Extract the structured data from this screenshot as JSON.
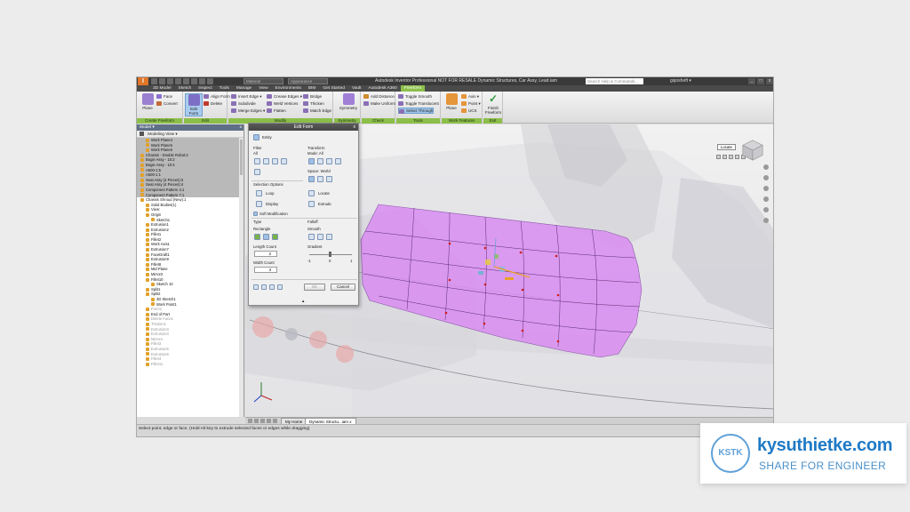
{
  "title_bar": {
    "logo": "I",
    "workspace_combo": "Material",
    "appearance_combo": "Appearance",
    "app_title": "Autodesk Inventor Professional      NOT FOR RESALE     Dynamic Structures, Car Assy, Lead.iam",
    "search_placeholder": "Search Help & Commands...",
    "user": "gsjosheft ▾",
    "win_min": "_",
    "win_max": "□",
    "win_close": "x"
  },
  "menu_tabs": [
    "3D Model",
    "Sketch",
    "Inspect",
    "Tools",
    "Manage",
    "View",
    "Environments",
    "BIM",
    "Get Started",
    "Vault",
    "Autodesk A360",
    "Freeform"
  ],
  "active_tab": "Freeform",
  "ribbon": {
    "create_freeform": {
      "title": "Create Freeform",
      "plane": "Plane",
      "face": "Face",
      "convert": "Convert"
    },
    "edit": {
      "title": "Edit",
      "edit_form": "Edit Form",
      "align_form": "Align Form",
      "delete": "Delete"
    },
    "modify": {
      "title": "Modify",
      "insert_edge": "Insert Edge ▾",
      "subdivide": "Subdivide",
      "merge_edges": "Merge Edges ▾",
      "crease_edges": "Crease Edges ▾",
      "weld_vertices": "Weld Vertices",
      "flatten": "Flatten",
      "bridge": "Bridge",
      "thicken": "Thicken",
      "match_edge": "Match Edge"
    },
    "symmetry": {
      "title": "Symmetry",
      "symmetry": "Symmetry"
    },
    "check": {
      "title": "Check",
      "add_distance": "Add Distance",
      "make_uniform": "Make Uniform"
    },
    "tools": {
      "title": "Tools",
      "toggle_smooth": "Toggle Smooth",
      "toggle_translucent": "Toggle Translucent",
      "select_through": "Select Through"
    },
    "work_features": {
      "title": "Work Features",
      "plane": "Plane",
      "axis": "Axis ▾",
      "point": "Point ▾",
      "ucs": "UCS"
    },
    "exit": {
      "title": "Exit",
      "finish_freeform": "Finish Freeform"
    }
  },
  "browser": {
    "header": "Model ▾",
    "close": "x",
    "view_label": "Modeling View ▾",
    "tree": [
      {
        "label": "Work Plane4",
        "indent": 1,
        "hi": true
      },
      {
        "label": "Work Plane5",
        "indent": 1,
        "hi": true
      },
      {
        "label": "Work Plane6",
        "indent": 1,
        "hi": true
      },
      {
        "label": "Chassis - Double Robot:2",
        "indent": 0,
        "hi": true
      },
      {
        "label": "Bogie Assy - 10:2",
        "indent": 0,
        "hi": true
      },
      {
        "label": "Bogie Assy - 10:4",
        "indent": 0,
        "hi": true
      },
      {
        "label": "A500-1:5",
        "indent": 0,
        "hi": true
      },
      {
        "label": "A500-1:1",
        "indent": 0,
        "hi": true
      },
      {
        "label": "Seat Assy (4 Pieces):3",
        "indent": 0,
        "hi": true
      },
      {
        "label": "Seat Assy (4 Pieces):4",
        "indent": 0,
        "hi": true
      },
      {
        "label": "Component Pattern 4:1",
        "indent": 0,
        "hi": true
      },
      {
        "label": "Component Pattern 7:1",
        "indent": 0,
        "hi": true
      },
      {
        "label": "Chassis Shroud (New):1",
        "indent": 0,
        "hi": false
      },
      {
        "label": "Solid Bodies(1)",
        "indent": 1,
        "hi": false
      },
      {
        "label": "View:",
        "indent": 1,
        "hi": false
      },
      {
        "label": "Origin",
        "indent": 1,
        "hi": false
      },
      {
        "label": "Sketch1",
        "indent": 2,
        "hi": false
      },
      {
        "label": "Extrusion1",
        "indent": 1,
        "hi": false
      },
      {
        "label": "Extrusion2",
        "indent": 1,
        "hi": false
      },
      {
        "label": "Fillet1",
        "indent": 1,
        "hi": false
      },
      {
        "label": "Fillet2",
        "indent": 1,
        "hi": false
      },
      {
        "label": "Work Axis1",
        "indent": 1,
        "hi": false
      },
      {
        "label": "Extrusion7",
        "indent": 1,
        "hi": false
      },
      {
        "label": "FaceDraft1",
        "indent": 1,
        "hi": false
      },
      {
        "label": "Extrusion9",
        "indent": 1,
        "hi": false
      },
      {
        "label": "Fillet8",
        "indent": 1,
        "hi": false
      },
      {
        "label": "Mid Plane",
        "indent": 1,
        "hi": false
      },
      {
        "label": "Mirror2",
        "indent": 1,
        "hi": false
      },
      {
        "label": "Fillet10",
        "indent": 1,
        "hi": false
      },
      {
        "label": "Sketch 10",
        "indent": 2,
        "hi": false
      },
      {
        "label": "Split1",
        "indent": 1,
        "hi": false
      },
      {
        "label": "Split2",
        "indent": 1,
        "hi": false
      },
      {
        "label": "3D Sketch1",
        "indent": 2,
        "hi": false
      },
      {
        "label": "Work Point1",
        "indent": 2,
        "hi": false
      },
      {
        "label": "Form1",
        "indent": 1,
        "hi": false,
        "dim": true
      },
      {
        "label": "End of Part",
        "indent": 1,
        "hi": false
      },
      {
        "label": "Delete Face1",
        "indent": 1,
        "hi": false,
        "dim": true
      },
      {
        "label": "Thicken1",
        "indent": 1,
        "hi": false,
        "dim": true
      },
      {
        "label": "Extrusion3",
        "indent": 1,
        "hi": false,
        "dim": true
      },
      {
        "label": "Extrusion4",
        "indent": 1,
        "hi": false,
        "dim": true
      },
      {
        "label": "Mirror1",
        "indent": 1,
        "hi": false,
        "dim": true
      },
      {
        "label": "Fillet3",
        "indent": 1,
        "hi": false,
        "dim": true
      },
      {
        "label": "Extrusion5",
        "indent": 1,
        "hi": false,
        "dim": true
      },
      {
        "label": "Extrusion6",
        "indent": 1,
        "hi": false,
        "dim": true
      },
      {
        "label": "Fillet4",
        "indent": 1,
        "hi": false,
        "dim": true
      },
      {
        "label": "Fillet11",
        "indent": 1,
        "hi": false,
        "dim": true
      }
    ]
  },
  "edit_form_dialog": {
    "title": "Edit Form",
    "close": "x",
    "entity": "Entity",
    "filter_label": "Filter",
    "filter_value": "All",
    "transform_label": "Transform",
    "mode_value": "Mode: All",
    "space_value": "Space: World",
    "selection_options": "Selection Options",
    "loop": "Loop",
    "display": "Display",
    "locate": "Locate",
    "extrude": "Extrude",
    "soft_modification": "Soft Modification",
    "type_label": "Type",
    "falloff_label": "Falloff",
    "rectangle": "Rectangle",
    "smooth": "Smooth",
    "length_count": "Length Count",
    "length_value": "2",
    "gradient": "Gradient",
    "width_count": "Width Count",
    "width_value": "3",
    "scale_min": "-1",
    "scale_mid": "0",
    "scale_max": "1",
    "ok": "OK",
    "cancel": "Cancel",
    "more": "▲"
  },
  "viewport": {
    "locate_tag": "Locate"
  },
  "doc_tabs": {
    "home": "My Home",
    "doc": "Dynamic Structu...iam",
    "doc_close": "x"
  },
  "status_bar": "Select point, edge or face. (Hold Alt key to extrude selected faces or edges while dragging)",
  "watermark": {
    "mark": "KSTK",
    "brand": "kysuthietke.com",
    "tagline": "SHARE FOR ENGINEER"
  },
  "colors": {
    "accent_green": "#8cbf4a",
    "freeform_magenta": "#d57ff0",
    "title_dark": "#3a3a3a",
    "brand_blue": "#1f7ac6"
  }
}
